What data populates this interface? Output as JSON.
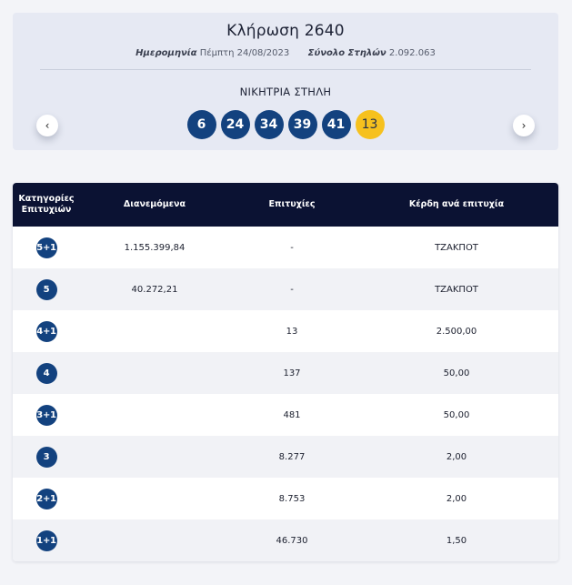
{
  "draw": {
    "title": "Κλήρωση 2640",
    "date_label": "Ημερομηνία",
    "date_value": "Πέμπτη 24/08/2023",
    "columns_label": "Σύνολο Στηλών",
    "columns_value": "2.092.063",
    "winning_label": "ΝΙΚΗΤΡΙΑ ΣΤΗΛΗ",
    "numbers": [
      "6",
      "24",
      "34",
      "39",
      "41"
    ],
    "bonus": "13",
    "prev_icon": "‹",
    "next_icon": "›"
  },
  "table": {
    "headers": {
      "category": "Κατηγορίες Επιτυχιών",
      "distributed": "Διανεμόμενα",
      "winners": "Επιτυχίες",
      "prize": "Κέρδη ανά επιτυχία"
    },
    "rows": [
      {
        "category": "5+1",
        "distributed": "1.155.399,84",
        "winners": "-",
        "prize": "ΤΖΑΚΠΟΤ"
      },
      {
        "category": "5",
        "distributed": "40.272,21",
        "winners": "-",
        "prize": "ΤΖΑΚΠΟΤ"
      },
      {
        "category": "4+1",
        "distributed": "",
        "winners": "13",
        "prize": "2.500,00"
      },
      {
        "category": "4",
        "distributed": "",
        "winners": "137",
        "prize": "50,00"
      },
      {
        "category": "3+1",
        "distributed": "",
        "winners": "481",
        "prize": "50,00"
      },
      {
        "category": "3",
        "distributed": "",
        "winners": "8.277",
        "prize": "2,00"
      },
      {
        "category": "2+1",
        "distributed": "",
        "winners": "8.753",
        "prize": "2,00"
      },
      {
        "category": "1+1",
        "distributed": "",
        "winners": "46.730",
        "prize": "1,50"
      }
    ]
  }
}
